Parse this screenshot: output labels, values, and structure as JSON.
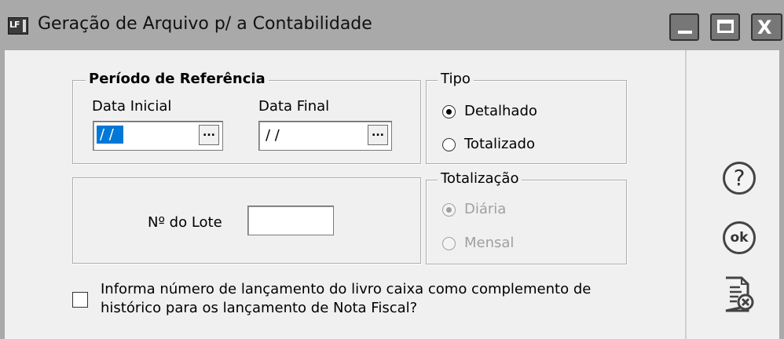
{
  "window": {
    "title": "Geração de Arquivo p/ a Contabilidade",
    "app_icon_text": "LF",
    "minimize_label": "_",
    "close_label": "X"
  },
  "periodo": {
    "legend": "Período de Referência",
    "data_inicial_label": "Data Inicial",
    "data_inicial_value": "/ /",
    "data_final_label": "Data Final",
    "data_final_value": "/ /",
    "picker_label": "..."
  },
  "tipo": {
    "legend": "Tipo",
    "options": [
      {
        "label": "Detalhado",
        "checked": true
      },
      {
        "label": "Totalizado",
        "checked": false
      }
    ]
  },
  "lote": {
    "label": "Nº do Lote",
    "value": ""
  },
  "totalizacao": {
    "legend": "Totalização",
    "options": [
      {
        "label": "Diária",
        "checked": true,
        "disabled": true
      },
      {
        "label": "Mensal",
        "checked": false,
        "disabled": true
      }
    ]
  },
  "livro_caixa": {
    "checked": false,
    "label_line1": "Informa número de lançamento do livro caixa como complemento de",
    "label_line2": "histórico para os lançamento de Nota Fiscal?"
  },
  "sidebar": {
    "help_symbol": "?",
    "ok_symbol": "ok"
  },
  "icons": [
    "app-icon",
    "minimize-icon",
    "maximize-icon",
    "close-icon",
    "help-icon",
    "ok-icon",
    "cancel-document-icon"
  ],
  "colors": {
    "titlebar": "#a9a9a9",
    "selection": "#0078d7",
    "panel": "#f0f0f0"
  }
}
